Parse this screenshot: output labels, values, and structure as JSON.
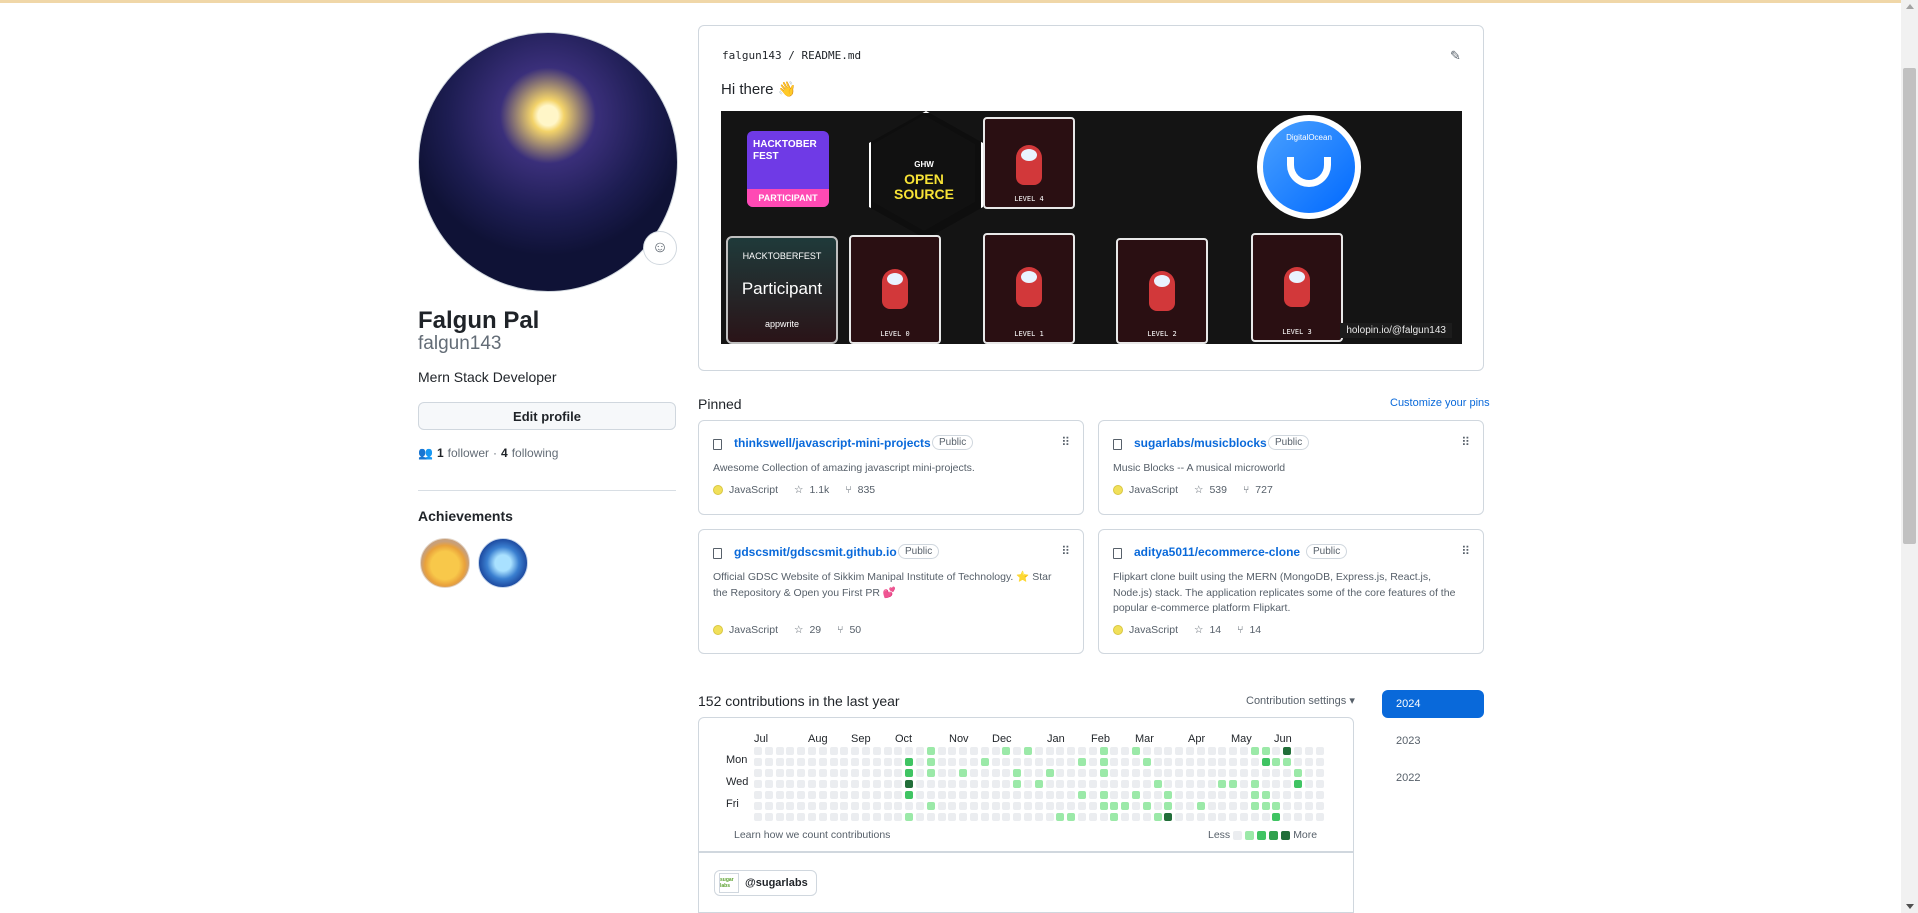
{
  "profile": {
    "name": "Falgun Pal",
    "login": "falgun143",
    "bio": "Mern Stack Developer",
    "edit_label": "Edit profile",
    "followers_count": "1",
    "followers_label": "follower",
    "separator": "·",
    "following_count": "4",
    "following_label": "following",
    "achievements_title": "Achievements"
  },
  "readme": {
    "path_user": "falgun143",
    "path_sep": "/",
    "path_file": "README.md",
    "greeting": "Hi there 👋",
    "banner": {
      "hacktober_lines": [
        "HACKTOBER",
        "FEST"
      ],
      "hacktober_label": "PARTICIPANT",
      "ghw_label": "GHW",
      "open_source": [
        "OPEN",
        "SOURCE"
      ],
      "digitalocean": "DigitalOcean",
      "appwrite_top": "HACKTOBERFEST",
      "appwrite_main": "Participant",
      "appwrite_brand": "appwrite",
      "levels": [
        "LEVEL 4",
        "LEVEL 0",
        "LEVEL 1",
        "LEVEL 2",
        "LEVEL 3"
      ],
      "holopin": "holopin.io/@falgun143"
    }
  },
  "pinned": {
    "title": "Pinned",
    "customize": "Customize your pins",
    "repos": [
      {
        "owner_repo": "thinkswell/javascript-mini-projects",
        "visibility": "Public",
        "description": "Awesome Collection of amazing javascript mini-projects.",
        "language": "JavaScript",
        "stars": "1.1k",
        "forks": "835"
      },
      {
        "owner_repo": "sugarlabs/musicblocks",
        "visibility": "Public",
        "description": "Music Blocks -- A musical microworld",
        "language": "JavaScript",
        "stars": "539",
        "forks": "727"
      },
      {
        "owner_repo": "gdscsmit/gdscsmit.github.io",
        "visibility": "Public",
        "description": "Official GDSC Website of Sikkim Manipal Institute of Technology. ⭐ Star the Repository & Open you First PR 💕",
        "language": "JavaScript",
        "stars": "29",
        "forks": "50"
      },
      {
        "owner_repo": "aditya5011/ecommerce-clone",
        "visibility": "Public",
        "description": "Flipkart clone built using the MERN (MongoDB, Express.js, React.js, Node.js) stack. The application replicates some of the core features of the popular e-commerce platform Flipkart.",
        "language": "JavaScript",
        "stars": "14",
        "forks": "14"
      }
    ]
  },
  "contributions": {
    "title": "152 contributions in the last year",
    "settings": "Contribution settings ▾",
    "months": [
      "Jul",
      "Aug",
      "Sep",
      "Oct",
      "Nov",
      "Dec",
      "Jan",
      "Feb",
      "Mar",
      "Apr",
      "May",
      "Jun"
    ],
    "days": [
      "Mon",
      "Wed",
      "Fri"
    ],
    "learn": "Learn how we count contributions",
    "less": "Less",
    "more": "More",
    "levels_colors": [
      "#ebedf0",
      "#9be9a8",
      "#40c463",
      "#30a14e",
      "#216e39"
    ],
    "org": "@sugarlabs",
    "org_logo_text": "sugar labs"
  },
  "years": [
    "2024",
    "2023",
    "2022"
  ],
  "colors": {
    "accent": "#0969da",
    "js": "#f1e05a"
  }
}
